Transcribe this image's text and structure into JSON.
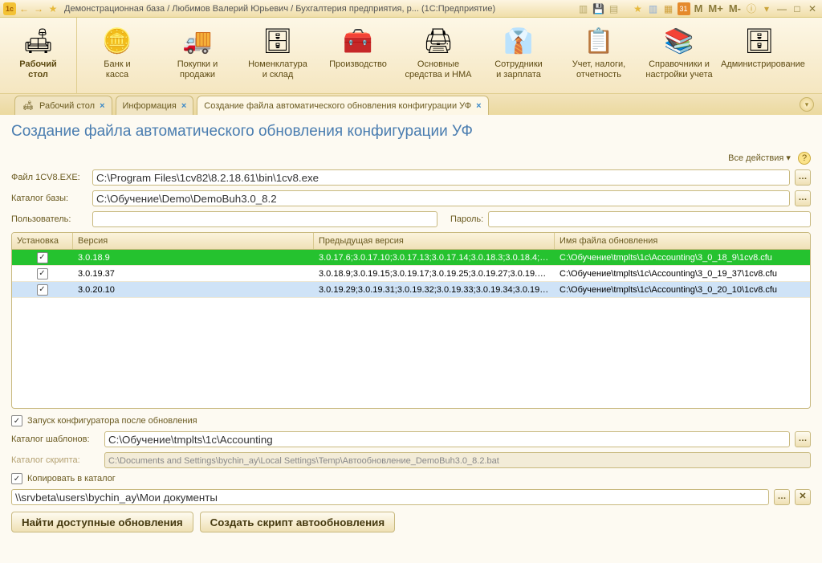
{
  "window": {
    "title": "Демонстрационная база / Любимов Валерий Юрьевич / Бухгалтерия предприятия, р... (1С:Предприятие)"
  },
  "title_icons": {
    "app": "1c",
    "back": "←",
    "fwd": "→",
    "star": "★",
    "r_star": "★",
    "r_file": "▥",
    "r_calc": "▦",
    "r_cal": "31",
    "m": "M",
    "mp": "M+",
    "mm": "M-",
    "info": "ⓘ",
    "min": "—",
    "max": "□",
    "close": "✕"
  },
  "toolbar": [
    {
      "label": "Рабочий\nстол",
      "icon": "🛋"
    },
    {
      "label": "Банк и\nкасса",
      "icon": "🪙"
    },
    {
      "label": "Покупки и\nпродажи",
      "icon": "🚚"
    },
    {
      "label": "Номенклатура\nи склад",
      "icon": "🗄"
    },
    {
      "label": "Производство",
      "icon": "🧰"
    },
    {
      "label": "Основные\nсредства и НМА",
      "icon": "🖨"
    },
    {
      "label": "Сотрудники\nи зарплата",
      "icon": "👔"
    },
    {
      "label": "Учет, налоги,\nотчетность",
      "icon": "📋"
    },
    {
      "label": "Справочники и\nнастройки учета",
      "icon": "📚"
    },
    {
      "label": "Администрирование",
      "icon": "🗄"
    }
  ],
  "tabs": [
    {
      "label": "Рабочий стол",
      "icon": "🛋",
      "closable": true
    },
    {
      "label": "Информация",
      "closable": true
    },
    {
      "label": "Создание файла автоматического обновления конфигурации УФ",
      "closable": true,
      "active": true
    }
  ],
  "page": {
    "title": "Создание файла автоматического обновления конфигурации УФ",
    "all_actions": "Все действия ▾"
  },
  "form": {
    "file_label": "Файл 1CV8.EXE:",
    "file_value": "C:\\Program Files\\1cv82\\8.2.18.61\\bin\\1cv8.exe",
    "base_label": "Каталог базы:",
    "base_value": "C:\\Обучение\\Demo\\DemoBuh3.0_8.2",
    "user_label": "Пользователь:",
    "user_value": "",
    "pass_label": "Пароль:",
    "pass_value": ""
  },
  "grid": {
    "headers": {
      "c0": "Установка",
      "c1": "Версия",
      "c2": "Предыдущая версия",
      "c3": "Имя файла обновления"
    },
    "rows": [
      {
        "checked": true,
        "class": "green",
        "version": "3.0.18.9",
        "prev": "3.0.17.6;3.0.17.10;3.0.17.13;3.0.17.14;3.0.18.3;3.0.18.4;3...",
        "file": "C:\\Обучение\\tmplts\\1c\\Accounting\\3_0_18_9\\1cv8.cfu"
      },
      {
        "checked": true,
        "class": "",
        "version": "3.0.19.37",
        "prev": "3.0.18.9;3.0.19.15;3.0.19.17;3.0.19.25;3.0.19.27;3.0.19.29;...",
        "file": "C:\\Обучение\\tmplts\\1c\\Accounting\\3_0_19_37\\1cv8.cfu"
      },
      {
        "checked": true,
        "class": "blue",
        "version": "3.0.20.10",
        "prev": "3.0.19.29;3.0.19.31;3.0.19.32;3.0.19.33;3.0.19.34;3.0.19.3...",
        "file": "C:\\Обучение\\tmplts\\1c\\Accounting\\3_0_20_10\\1cv8.cfu"
      }
    ]
  },
  "options": {
    "run_after_label": "Запуск конфигуратора после обновления",
    "run_after_checked": true,
    "tpl_label": "Каталог шаблонов:",
    "tpl_value": "C:\\Обучение\\tmplts\\1c\\Accounting",
    "script_label": "Каталог скрипта:",
    "script_value": "C:\\Documents and Settings\\bychin_ay\\Local Settings\\Temp\\Автообновление_DemoBuh3.0_8.2.bat",
    "copy_label": "Копировать в каталог",
    "copy_checked": true,
    "copy_value": "\\\\srvbeta\\users\\bychin_ay\\Мои документы"
  },
  "buttons": {
    "find": "Найти доступные обновления",
    "create": "Создать скрипт автообновления"
  }
}
